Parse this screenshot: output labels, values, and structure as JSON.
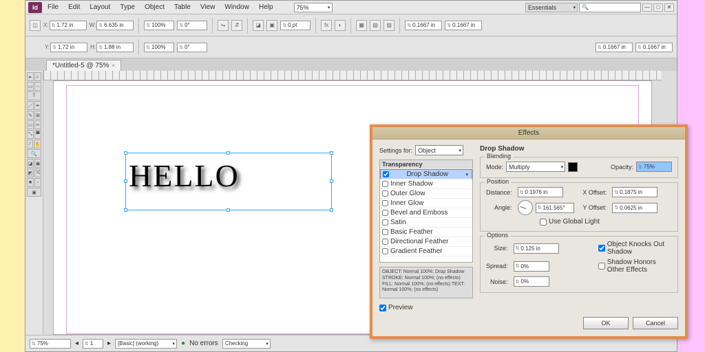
{
  "menu": {
    "items": [
      "File",
      "Edit",
      "Layout",
      "Type",
      "Object",
      "Table",
      "View",
      "Window",
      "Help"
    ],
    "zoom": "75%",
    "workspace": "Essentials"
  },
  "controlbar": {
    "x": "1.72 in",
    "y": "1.72 in",
    "w": "6.635 in",
    "h": "1.88 in",
    "scale": "100%",
    "rotate": "0°",
    "stroke_w": "0 pt",
    "ref1": "0.1667 in",
    "ref2": "0.1667 in",
    "ref3": "0.1667 in",
    "ref4": "0.1667 in"
  },
  "tab": {
    "title": "*Untitled-5 @ 75%"
  },
  "canvas": {
    "text": "HELLO"
  },
  "status": {
    "zoom": "75%",
    "page": "1",
    "preflight": "[Basic] (working)",
    "errors": "No errors",
    "checking": "Checking"
  },
  "dialog": {
    "title": "Effects",
    "settings_for_label": "Settings for:",
    "settings_for": "Object",
    "section_title": "Drop Shadow",
    "fx_header": "Transparency",
    "fx": [
      {
        "name": "Drop Shadow",
        "on": true,
        "sel": true
      },
      {
        "name": "Inner Shadow",
        "on": false
      },
      {
        "name": "Outer Glow",
        "on": false
      },
      {
        "name": "Inner Glow",
        "on": false
      },
      {
        "name": "Bevel and Emboss",
        "on": false
      },
      {
        "name": "Satin",
        "on": false
      },
      {
        "name": "Basic Feather",
        "on": false
      },
      {
        "name": "Directional Feather",
        "on": false
      },
      {
        "name": "Gradient Feather",
        "on": false
      }
    ],
    "summary": "OBJECT: Normal 100%; Drop Shadow\nSTROKE: Normal 100%; (no effects)\nFILL: Normal 100%; (no effects)\nTEXT: Normal 100%; (no effects)",
    "blending": {
      "legend": "Blending",
      "mode_label": "Mode:",
      "mode": "Multiply",
      "opacity_label": "Opacity:",
      "opacity": "75%"
    },
    "position": {
      "legend": "Position",
      "distance_label": "Distance:",
      "distance": "0.1976 in",
      "angle_label": "Angle:",
      "angle": "161.565°",
      "global_label": "Use Global Light",
      "xoff_label": "X Offset:",
      "xoff": "0.1875 in",
      "yoff_label": "Y Offset:",
      "yoff": "0.0625 in"
    },
    "options": {
      "legend": "Options",
      "size_label": "Size:",
      "size": "0.125 in",
      "spread_label": "Spread:",
      "spread": "0%",
      "noise_label": "Noise:",
      "noise": "0%",
      "knockout_label": "Object Knocks Out Shadow",
      "honors_label": "Shadow Honors Other Effects"
    },
    "preview_label": "Preview",
    "ok": "OK",
    "cancel": "Cancel"
  }
}
